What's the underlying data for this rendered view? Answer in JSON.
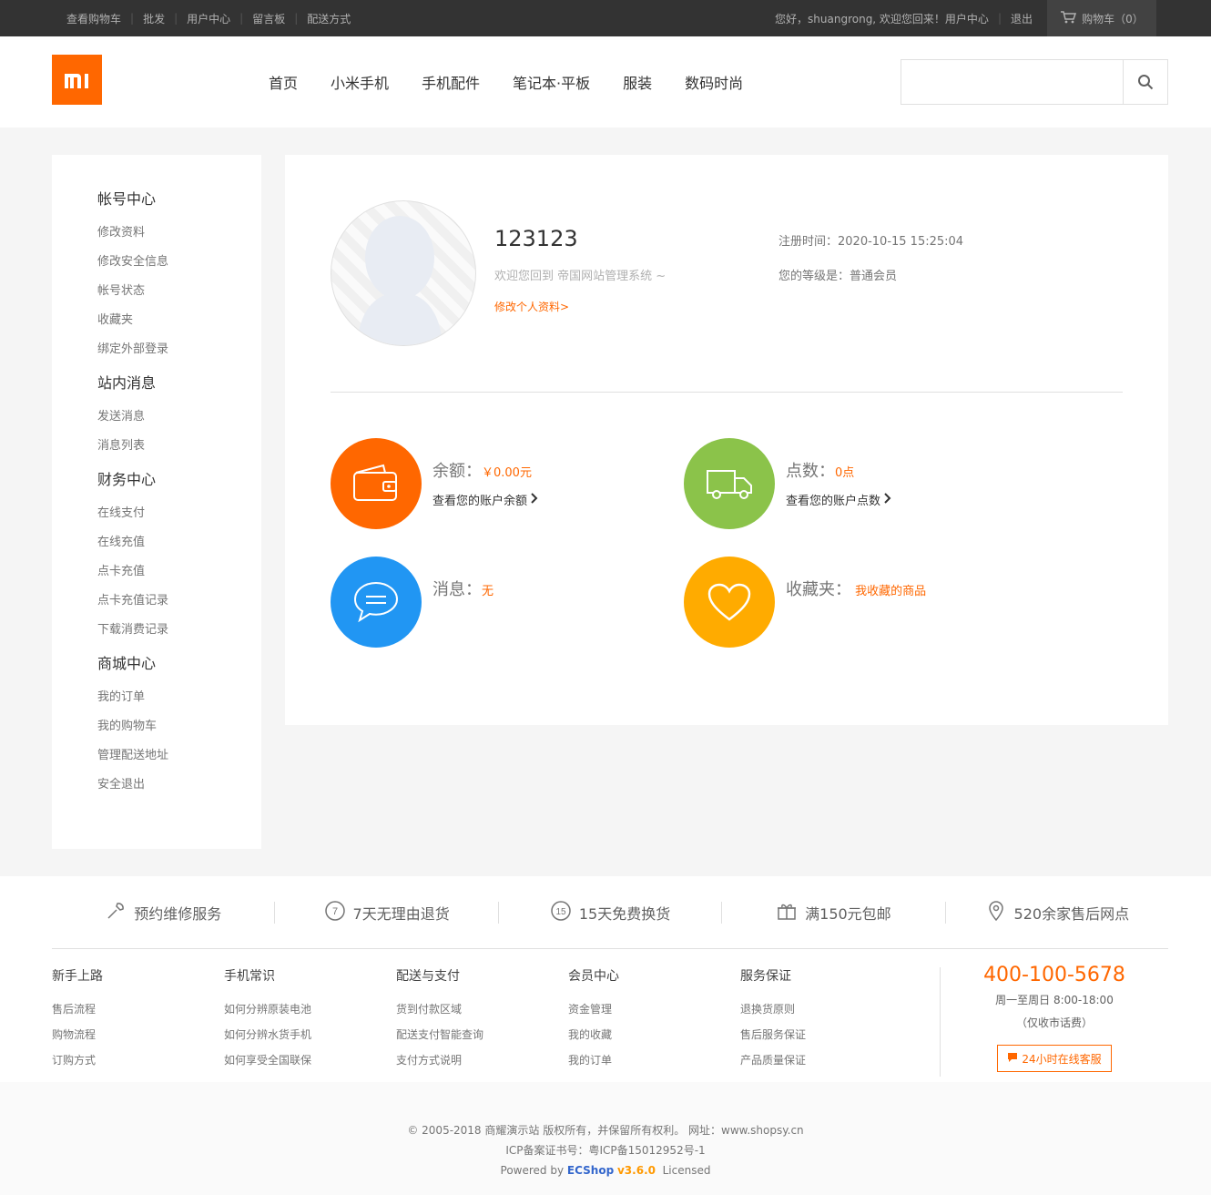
{
  "topbar": {
    "links": [
      "查看购物车",
      "批发",
      "用户中心",
      "留言板",
      "配送方式"
    ],
    "greeting": "您好，shuangrong, 欢迎您回来！用户中心",
    "logout": "退出",
    "cart": "购物车（0）"
  },
  "header": {
    "logo": "mi",
    "nav": [
      "首页",
      "小米手机",
      "手机配件",
      "笔记本·平板",
      "服装",
      "数码时尚"
    ],
    "search_placeholder": ""
  },
  "sidebar": [
    {
      "title": "帐号中心",
      "items": [
        "修改资料",
        "修改安全信息",
        "帐号状态",
        "收藏夹",
        "绑定外部登录"
      ]
    },
    {
      "title": "站内消息",
      "items": [
        "发送消息",
        "消息列表"
      ]
    },
    {
      "title": "财务中心",
      "items": [
        "在线支付",
        "在线充值",
        "点卡充值",
        "点卡充值记录",
        "下载消费记录"
      ]
    },
    {
      "title": "商城中心",
      "items": [
        "我的订单",
        "我的购物车",
        "管理配送地址",
        "安全退出"
      ]
    }
  ],
  "profile": {
    "username": "123123",
    "welcome": "欢迎您回到 帝国网站管理系统 ~",
    "edit_link": "修改个人资料>",
    "reg_time": "注册时间：2020-10-15 15:25:04",
    "level": "您的等级是：普通会员"
  },
  "stats": {
    "balance": {
      "label": "余额：",
      "value": "￥0.00元",
      "sub": "查看您的账户余额",
      "color": "#ff6700"
    },
    "points": {
      "label": "点数：",
      "value": "0点",
      "sub": "查看您的账户点数",
      "color": "#8bc34a"
    },
    "messages": {
      "label": "消息：",
      "value": "无",
      "color": "#2196f3"
    },
    "favorites": {
      "label": "收藏夹：",
      "value": "我收藏的商品",
      "color": "#ffab00"
    }
  },
  "services": [
    "预约维修服务",
    "7天无理由退货",
    "15天免费换货",
    "满150元包邮",
    "520余家售后网点"
  ],
  "footer_cols": [
    {
      "title": "新手上路",
      "links": [
        "售后流程",
        "购物流程",
        "订购方式"
      ]
    },
    {
      "title": "手机常识",
      "links": [
        "如何分辨原装电池",
        "如何分辨水货手机",
        "如何享受全国联保"
      ]
    },
    {
      "title": "配送与支付",
      "links": [
        "货到付款区域",
        "配送支付智能查询",
        "支付方式说明"
      ]
    },
    {
      "title": "会员中心",
      "links": [
        "资金管理",
        "我的收藏",
        "我的订单"
      ]
    },
    {
      "title": "服务保证",
      "links": [
        "退换货原则",
        "售后服务保证",
        "产品质量保证"
      ]
    }
  ],
  "contact": {
    "phone": "400-100-5678",
    "hours": "周一至周日 8:00-18:00",
    "note": "（仅收市话费）",
    "chat": "24小时在线客服"
  },
  "copyright": {
    "line1": "© 2005-2018 商耀演示站 版权所有，并保留所有权利。 网址：www.shopsy.cn",
    "line2": "ICP备案证书号：粤ICP备15012952号-1",
    "powered": "Powered by",
    "ecshop": "ECShop",
    "version": "v3.6.0",
    "licensed": "Licensed"
  }
}
